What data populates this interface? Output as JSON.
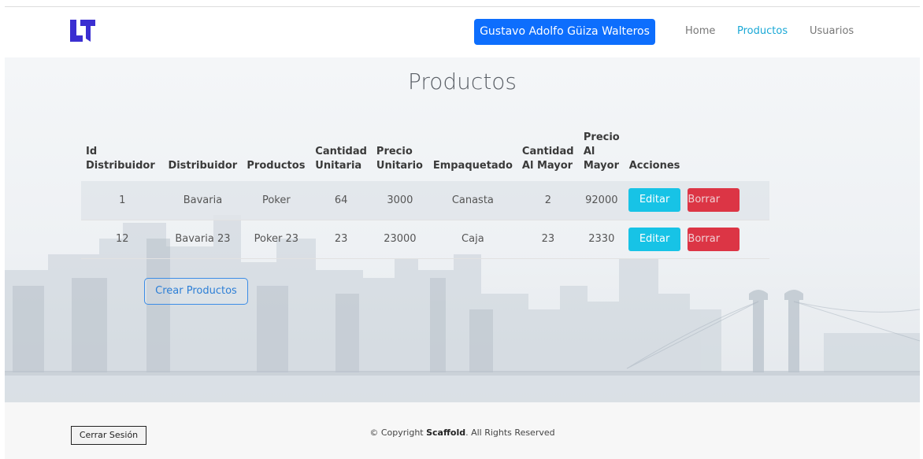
{
  "header": {
    "user_name": "Gustavo Adolfo Güiza Walteros",
    "nav": [
      "Home",
      "Productos",
      "Usuarios"
    ],
    "active_nav": "Productos"
  },
  "page": {
    "title": "Productos"
  },
  "table": {
    "headers": [
      "Id Distribuidor",
      "Distribuidor",
      "Productos",
      "Cantidad Unitaria",
      "Precio Unitario",
      "Empaquetado",
      "Cantidad Al Mayor",
      "Precio Al Mayor",
      "Acciones"
    ],
    "header_lines": [
      [
        "Id",
        "Distribuidor"
      ],
      [
        "Distribuidor"
      ],
      [
        "Productos"
      ],
      [
        "Cantidad",
        "Unitaria"
      ],
      [
        "Precio",
        "Unitario"
      ],
      [
        "Empaquetado"
      ],
      [
        "Cantidad",
        "Al Mayor"
      ],
      [
        "Precio",
        "Al",
        "Mayor"
      ],
      [
        "Acciones"
      ]
    ],
    "rows": [
      [
        "1",
        "Bavaria",
        "Poker",
        "64",
        "3000",
        "Canasta",
        "2",
        "92000"
      ],
      [
        "12",
        "Bavaria 23",
        "Poker 23",
        "23",
        "23000",
        "Caja",
        "23",
        "2330"
      ]
    ],
    "edit_label": "Editar",
    "delete_label": "Borrar"
  },
  "create_label": "Crear Productos",
  "footer": {
    "logout_label": "Cerrar Sesión",
    "copyright_prefix": "© Copyright ",
    "copyright_brand": "Scaffold",
    "copyright_suffix": ". All Rights Reserved"
  },
  "colors": {
    "primary": "#0d6efd",
    "active_nav": "#19a8d6",
    "edit": "#17c3e6",
    "delete": "#dc3545",
    "logo": "#3b2fd1"
  },
  "icons": {
    "logo": "brand-logo-icon"
  }
}
